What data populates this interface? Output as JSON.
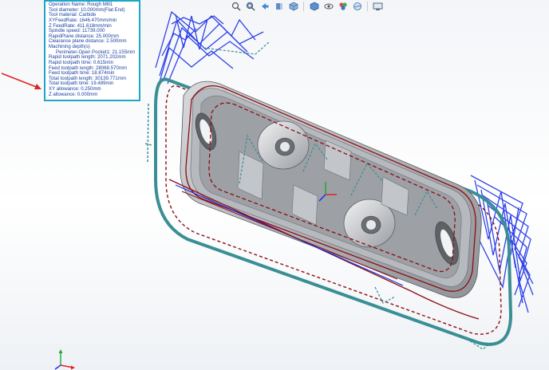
{
  "info_panel": {
    "lines": [
      "Operation Name: Rough Mill1",
      "Tool diameter: 10.000mm(Flat End)",
      "Tool material: Carbide",
      "XYFeedRate: 1646.470mm/min",
      "Z FeedRate: 411.618mm/min",
      "Spindle speed: 11739.000",
      "RapidPlane distance: 25.000mm",
      "Clearance plane distance: 2.500mm",
      "Machining depth(s)",
      "Perimeter-Open Pocket1: 21.155mm",
      "Rapid toolpath length: 2071.202mm",
      "Rapid toolpath time: 0.615min",
      "Feed toolpath length: 28068.570mm",
      "Feed toolpath time: 18.874min",
      "Total toolpath length: 30139.771mm",
      "Total toolpath time: 19.489min",
      "XY allowance: 0.250mm",
      "Z allowance: 0.000mm"
    ]
  },
  "toolbar": {
    "icons": [
      "zoom-to-fit-icon",
      "zoom-to-area-icon",
      "previous-view-icon",
      "section-view-icon",
      "view-orientation-icon",
      "display-style-icon",
      "hide-show-items-icon",
      "edit-appearance-icon",
      "apply-scene-icon",
      "view-settings-icon"
    ]
  },
  "colors": {
    "panel_border": "#1ea6c7",
    "panel_text": "#1b3f9e",
    "annotation_arrow": "#e02424",
    "toolpath_blue": "#1a2fe6",
    "toolpath_teal": "#3a8f95",
    "profile_red": "#8b0f14"
  }
}
